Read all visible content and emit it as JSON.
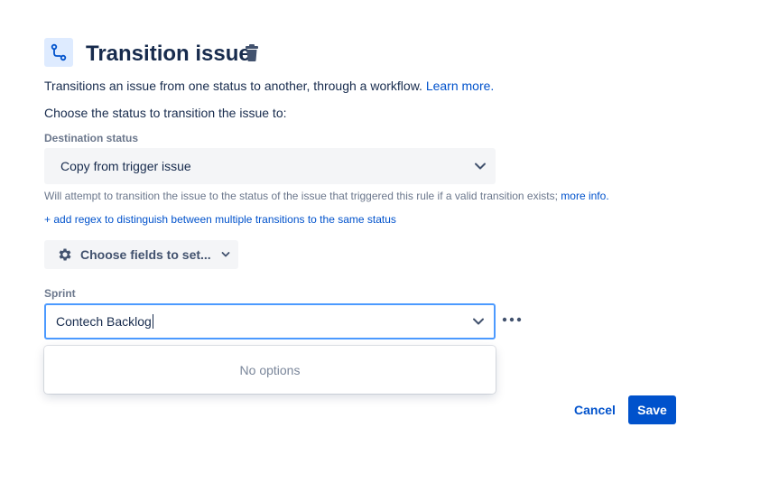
{
  "header": {
    "title": "Transition issue",
    "icon": "transition-icon",
    "delete_icon": "trash-icon"
  },
  "description": {
    "text": "Transitions an issue from one status to another, through a workflow.",
    "link": "Learn more."
  },
  "instruction": "Choose the status to transition the issue to:",
  "destination": {
    "label": "Destination status",
    "value": "Copy from trigger issue",
    "helper_text": "Will attempt to transition the issue to the status of the issue that triggered this rule if a valid transition exists;",
    "helper_link": "more info."
  },
  "regex_link": "+ add regex to distinguish between multiple transitions to the same status",
  "fields_button": {
    "label": "Choose fields to set...",
    "icon": "gear-icon"
  },
  "sprint": {
    "label": "Sprint",
    "value": "Contech Backlog",
    "menu_empty": "No options"
  },
  "actions": {
    "cancel": "Cancel",
    "save": "Save"
  },
  "colors": {
    "primary": "#0052cc",
    "focus_border": "#4c9aff",
    "text": "#172b4d",
    "subtle_text": "#6b778c",
    "field_bg": "#f4f5f7"
  }
}
